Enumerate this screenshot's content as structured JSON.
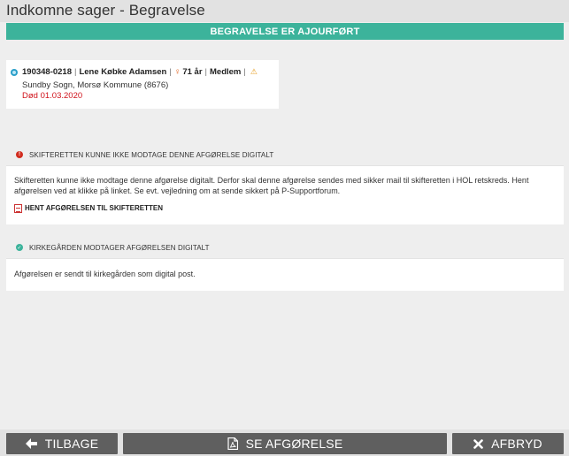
{
  "window": {
    "title": "Indkomne sager - Begravelse"
  },
  "banner": {
    "text": "BEGRAVELSE ER AJOURFØRT",
    "color": "#3cb39b"
  },
  "person": {
    "id": "190348-0218",
    "name": "Lene Købke Adamsen",
    "gender_icon": "female-icon",
    "age": "71 år",
    "membership": "Medlem",
    "parish": "Sundby Sogn, Morsø Kommune (8676)",
    "death": "Død 01.03.2020",
    "death_color": "#d0121b"
  },
  "sections": [
    {
      "status_icon": "error-icon",
      "heading": "SKIFTERETTEN KUNNE IKKE MODTAGE DENNE AFGØRELSE DIGITALT",
      "body": "Skifteretten kunne ikke modtage denne afgørelse digitalt. Derfor skal denne afgørelse sendes med sikker mail til skifteretten i HOL retskreds. Hent afgørelsen ved at klikke på linket. Se evt. vejledning om at sende sikkert på P-Supportforum.",
      "link_label": "HENT AFGØRELSEN TIL SKIFTERETTEN",
      "link_icon": "pdf-icon"
    },
    {
      "status_icon": "check-icon",
      "heading": "KIRKEGÅRDEN MODTAGER AFGØRELSEN DIGITALT",
      "body": "Afgørelsen er sendt til kirkegården som digital post."
    }
  ],
  "footer": {
    "back_label": "TILBAGE",
    "view_label": "SE AFGØRELSE",
    "cancel_label": "AFBRYD"
  }
}
